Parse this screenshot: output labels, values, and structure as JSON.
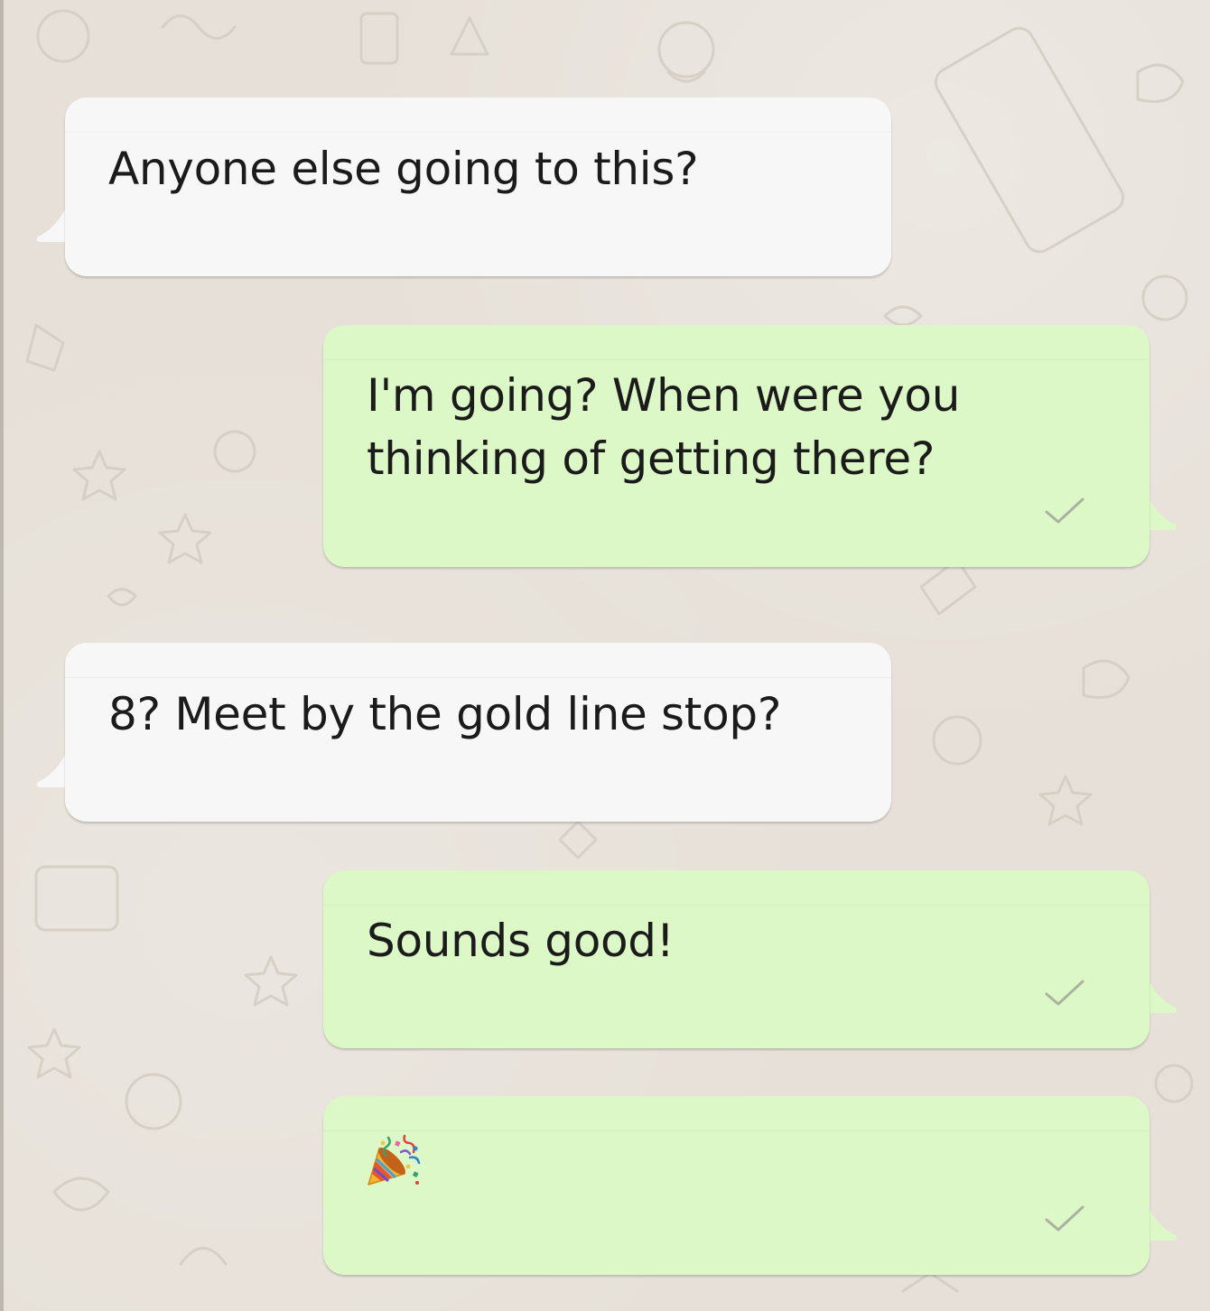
{
  "chat": {
    "messages": [
      {
        "direction": "incoming",
        "text": "Anyone else going to this?"
      },
      {
        "direction": "outgoing",
        "text": "I'm going? When were you\nthinking of getting there?",
        "status": "sent-check-icon"
      },
      {
        "direction": "incoming",
        "text": "8? Meet by the gold line stop?"
      },
      {
        "direction": "outgoing",
        "text": "Sounds good!",
        "status": "sent-check-icon"
      },
      {
        "direction": "outgoing",
        "emoji": "party-popper-icon",
        "status": "sent-check-icon"
      }
    ]
  },
  "colors": {
    "incoming_bubble": "#f7f7f7",
    "outgoing_bubble": "#dcf8c6",
    "wallpaper": "#e6e0d8",
    "check": "#a9b3a0"
  }
}
